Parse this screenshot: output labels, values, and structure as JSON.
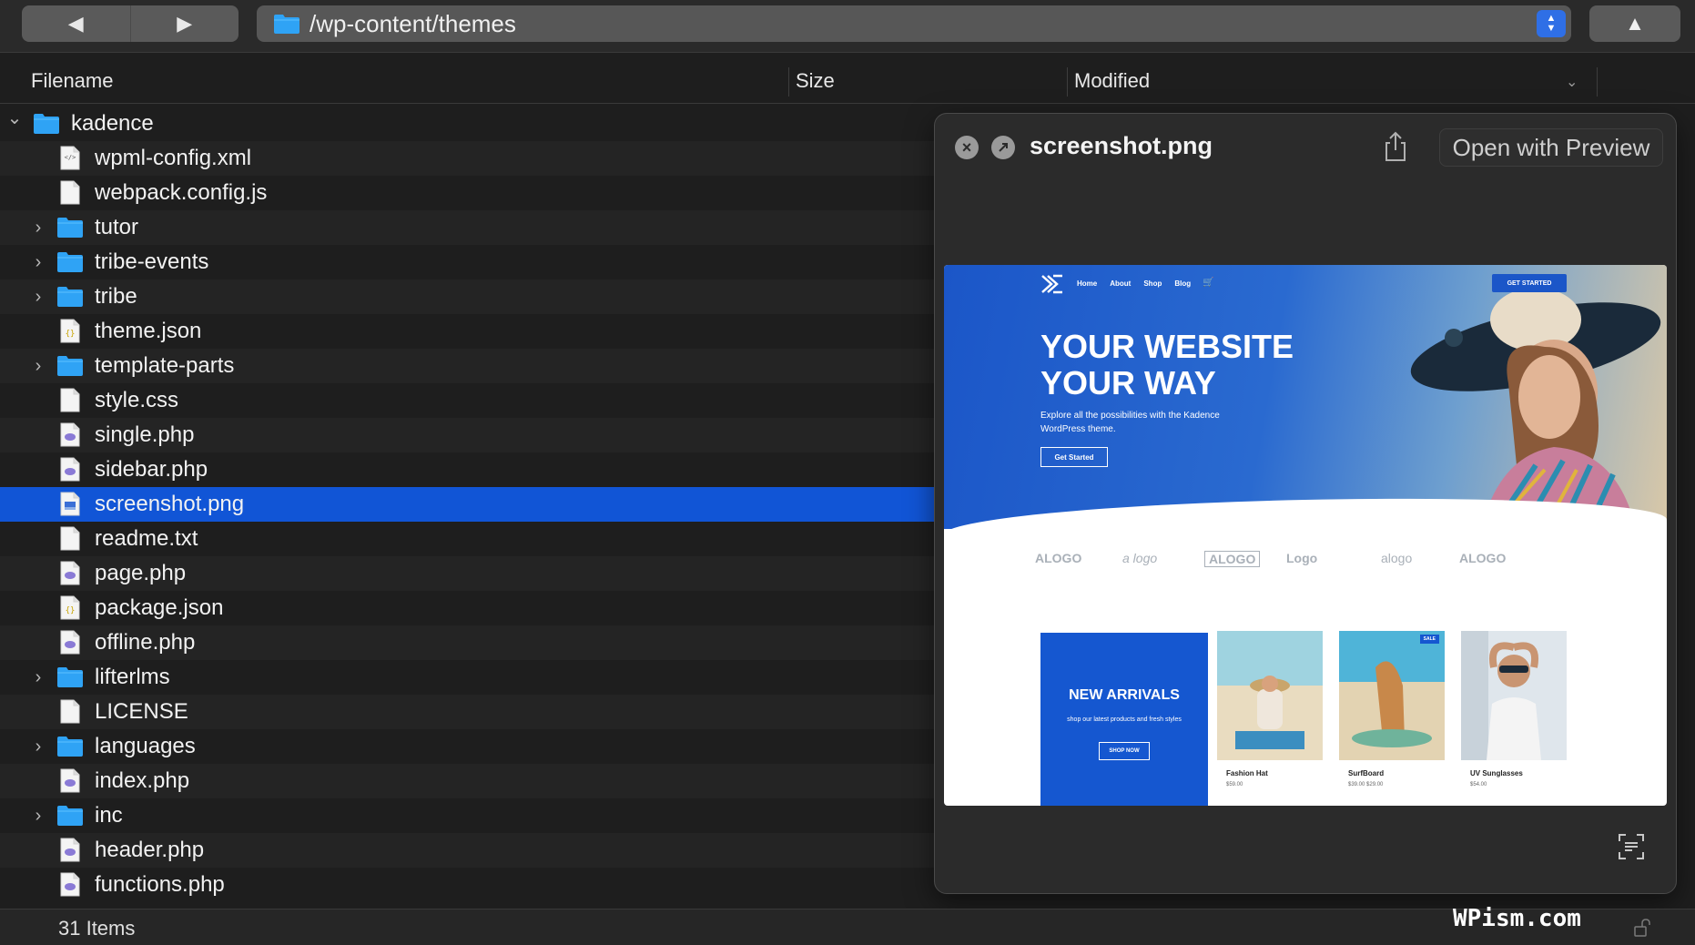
{
  "toolbar": {
    "back_glyph": "◀",
    "forward_glyph": "▶",
    "path": "/wp-content/themes",
    "up_glyph": "▲"
  },
  "columns": {
    "filename": "Filename",
    "size": "Size",
    "modified": "Modified"
  },
  "files": [
    {
      "name": "kadence",
      "type": "folder",
      "expanded": true,
      "level": 0
    },
    {
      "name": "wpml-config.xml",
      "type": "xml",
      "level": 1
    },
    {
      "name": "webpack.config.js",
      "type": "file",
      "level": 1
    },
    {
      "name": "tutor",
      "type": "folder",
      "level": 1
    },
    {
      "name": "tribe-events",
      "type": "folder",
      "level": 1
    },
    {
      "name": "tribe",
      "type": "folder",
      "level": 1
    },
    {
      "name": "theme.json",
      "type": "json",
      "level": 1
    },
    {
      "name": "template-parts",
      "type": "folder",
      "level": 1
    },
    {
      "name": "style.css",
      "type": "file",
      "level": 1
    },
    {
      "name": "single.php",
      "type": "php",
      "level": 1
    },
    {
      "name": "sidebar.php",
      "type": "php",
      "level": 1
    },
    {
      "name": "screenshot.png",
      "type": "image",
      "level": 1,
      "selected": true
    },
    {
      "name": "readme.txt",
      "type": "file",
      "level": 1
    },
    {
      "name": "page.php",
      "type": "php",
      "level": 1
    },
    {
      "name": "package.json",
      "type": "json",
      "level": 1
    },
    {
      "name": "offline.php",
      "type": "php",
      "level": 1
    },
    {
      "name": "lifterlms",
      "type": "folder",
      "level": 1
    },
    {
      "name": "LICENSE",
      "type": "file",
      "level": 1
    },
    {
      "name": "languages",
      "type": "folder",
      "level": 1
    },
    {
      "name": "index.php",
      "type": "php",
      "level": 1
    },
    {
      "name": "inc",
      "type": "folder",
      "level": 1
    },
    {
      "name": "header.php",
      "type": "php",
      "level": 1
    },
    {
      "name": "functions.php",
      "type": "php",
      "level": 1
    }
  ],
  "status": {
    "items_count": "31 Items"
  },
  "watermark": "WPism.com",
  "quicklook": {
    "title": "screenshot.png",
    "open_with": "Open with Preview",
    "preview": {
      "nav": [
        "Home",
        "About",
        "Shop",
        "Blog"
      ],
      "cta": "GET STARTED",
      "hero_title": "YOUR WEBSITE YOUR WAY",
      "hero_sub": "Explore all the possibilities with the Kadence WordPress theme.",
      "hero_button": "Get Started",
      "logos": [
        "ALOGO",
        "a logo",
        "ALOGO",
        "Logo",
        "alogo",
        "ALOGO"
      ],
      "new_arrivals_title": "NEW ARRIVALS",
      "new_arrivals_sub": "shop our latest products and fresh styles",
      "new_arrivals_button": "SHOP NOW",
      "products": [
        {
          "name": "Fashion Hat",
          "price": "$59.00"
        },
        {
          "name": "SurfBoard",
          "price": "$39.00 $29.00",
          "badge": "SALE"
        },
        {
          "name": "UV Sunglasses",
          "price": "$54.00"
        }
      ]
    }
  },
  "colors": {
    "selection": "#1155d6",
    "folder": "#2fa3f5",
    "accent": "#2f6fe6"
  }
}
